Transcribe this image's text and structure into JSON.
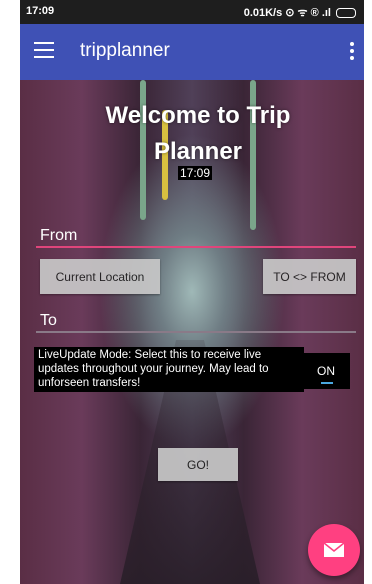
{
  "status_bar": {
    "time": "17:09",
    "indicators": "0.01K/s ⊙ ᯤ ® .ıl"
  },
  "app_bar": {
    "title": "tripplanner"
  },
  "main": {
    "welcome": "Welcome to Trip Planner",
    "clock": "17:09",
    "from_label": "From",
    "current_location_button": "Current Location",
    "swap_button": "TO <> FROM",
    "to_label": "To",
    "live_update_text": "LiveUpdate Mode: Select this to receive live updates throughout your journey. May lead to unforseen transfers!",
    "live_toggle": "ON",
    "go_button": "GO!"
  },
  "colors": {
    "app_bar": "#3f51b5",
    "accent": "#ff4081",
    "toggle_indicator": "#4aa8e0"
  }
}
